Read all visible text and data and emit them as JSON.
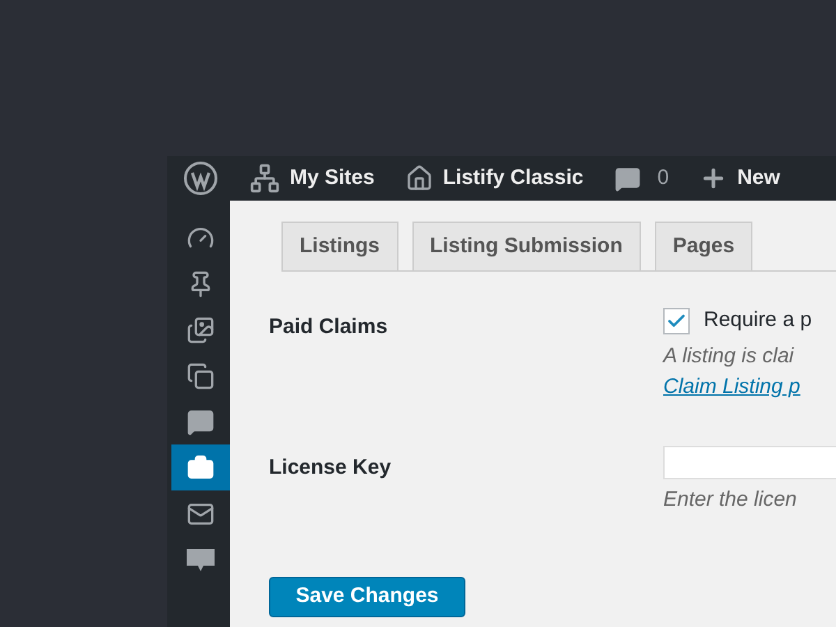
{
  "admin_bar": [
    {
      "kind": "logo"
    },
    {
      "kind": "sites",
      "label": "My Sites"
    },
    {
      "kind": "home",
      "label": "Listify Classic"
    },
    {
      "kind": "comments",
      "label": "0"
    },
    {
      "kind": "new",
      "label": "New"
    }
  ],
  "sidebar": {
    "items": [
      {
        "kind": "dashboard",
        "selected": false
      },
      {
        "kind": "pin",
        "selected": false
      },
      {
        "kind": "media",
        "selected": false
      },
      {
        "kind": "pages",
        "selected": false
      },
      {
        "kind": "comments",
        "selected": false
      },
      {
        "kind": "briefcase",
        "selected": true
      },
      {
        "kind": "mail",
        "selected": false
      },
      {
        "kind": "woo",
        "selected": false
      }
    ]
  },
  "tabs": [
    {
      "label": "Listings"
    },
    {
      "label": "Listing Submission"
    },
    {
      "label": "Pages"
    }
  ],
  "settings": {
    "paid_claims": {
      "label": "Paid Claims",
      "checkbox_label": "Require a p",
      "checked": true,
      "description": "A listing is clai",
      "link": "Claim Listing p"
    },
    "license_key": {
      "label": "License Key",
      "description": "Enter the licen"
    }
  },
  "save_button": "Save Changes"
}
